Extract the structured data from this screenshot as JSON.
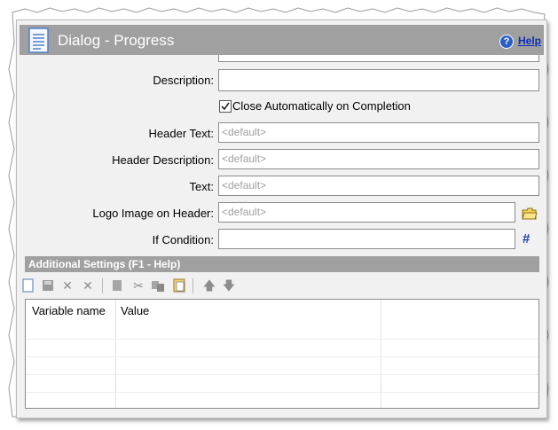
{
  "window": {
    "title": "Dialog - Progress",
    "help_label": "Help"
  },
  "form": {
    "description": {
      "label": "Description:",
      "value": ""
    },
    "close_auto": {
      "label": "Close Automatically on Completion",
      "checked": true
    },
    "header_text": {
      "label": "Header Text:",
      "placeholder": "<default>"
    },
    "header_description": {
      "label": "Header Description:",
      "placeholder": "<default>"
    },
    "text": {
      "label": "Text:",
      "placeholder": "<default>"
    },
    "logo_image": {
      "label": "Logo Image on Header:",
      "placeholder": "<default>"
    },
    "if_condition": {
      "label": "If Condition:",
      "value": "",
      "hash_symbol": "#"
    }
  },
  "additional": {
    "title": "Additional Settings (F1 - Help)",
    "toolbar_icons": [
      "new-icon",
      "save-icon",
      "delete-icon",
      "remove-icon",
      "copy-icon",
      "cut-icon",
      "duplicate-icon",
      "paste-icon",
      "arrow-up-icon",
      "arrow-down-icon"
    ],
    "columns": [
      "Variable name",
      "Value"
    ]
  },
  "colors": {
    "header_bg": "#a0a0a0",
    "panel_bg": "#f1f1f1",
    "link": "#0b2eb5",
    "hash": "#1a3bb0"
  }
}
